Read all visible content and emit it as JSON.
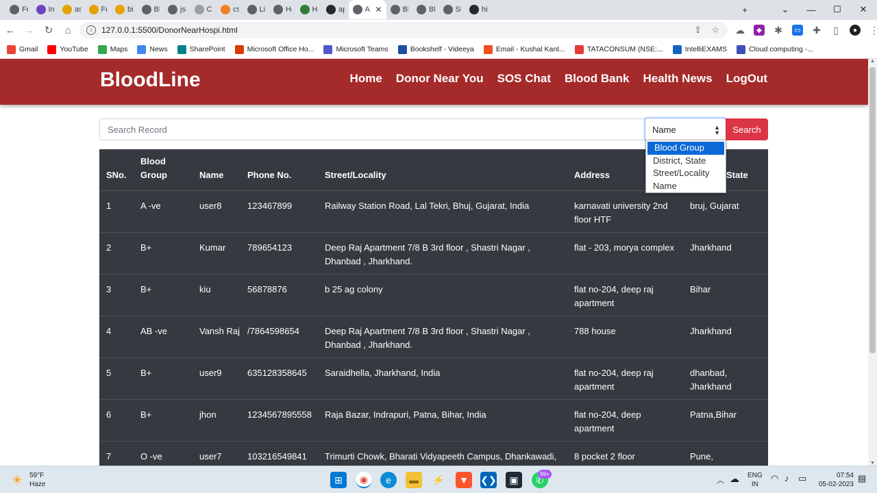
{
  "browser": {
    "tabs": [
      {
        "title": "Frien",
        "icon": "globe-icon",
        "color": "#5f6368"
      },
      {
        "title": "Introc",
        "icon": "bootstrap-icon",
        "color": "#6f42c1"
      },
      {
        "title": "assan",
        "icon": "glitch-icon",
        "color": "#e8a200"
      },
      {
        "title": "Frien",
        "icon": "glitch-icon",
        "color": "#e8a200"
      },
      {
        "title": "bihar",
        "icon": "glitch-icon",
        "color": "#e8a200"
      },
      {
        "title": "Blood",
        "icon": "globe-icon",
        "color": "#5f6368"
      },
      {
        "title": "js-tut",
        "icon": "globe-icon",
        "color": "#5f6368"
      },
      {
        "title": "Creat",
        "icon": "cloud-icon",
        "color": "#9aa0a6"
      },
      {
        "title": "css - ",
        "icon": "stack-icon",
        "color": "#f48024"
      },
      {
        "title": "Live s",
        "icon": "doc-icon",
        "color": "#5f6368"
      },
      {
        "title": "Home",
        "icon": "globe-icon",
        "color": "#5f6368"
      },
      {
        "title": "How t",
        "icon": "code-icon",
        "color": "#2e7d32"
      },
      {
        "title": "apyh",
        "icon": "github-icon",
        "color": "#24292e"
      },
      {
        "title": "A",
        "icon": "globe-icon",
        "color": "#5f6368",
        "active": true
      },
      {
        "title": "Blood",
        "icon": "globe-icon",
        "color": "#5f6368"
      },
      {
        "title": "Blood",
        "icon": "globe-icon",
        "color": "#5f6368"
      },
      {
        "title": "Sign",
        "icon": "globe-icon",
        "color": "#5f6368"
      },
      {
        "title": "hitma",
        "icon": "github-icon",
        "color": "#24292e"
      }
    ],
    "url": "127.0.0.1:5500/DonorNearHospi.html",
    "bookmarks": [
      {
        "label": "Gmail",
        "icon": "gmail-icon",
        "color": "#ea4335"
      },
      {
        "label": "YouTube",
        "icon": "youtube-icon",
        "color": "#ff0000"
      },
      {
        "label": "Maps",
        "icon": "maps-icon",
        "color": "#34a853"
      },
      {
        "label": "News",
        "icon": "news-icon",
        "color": "#4285f4"
      },
      {
        "label": "SharePoint",
        "icon": "sharepoint-icon",
        "color": "#038387"
      },
      {
        "label": "Microsoft Office Ho...",
        "icon": "office-icon",
        "color": "#d83b01"
      },
      {
        "label": "Microsoft Teams",
        "icon": "teams-icon",
        "color": "#5059c9"
      },
      {
        "label": "Bookshelf - Videeya",
        "icon": "bookshelf-icon",
        "color": "#1a4fa0"
      },
      {
        "label": "Email - Kushal Kant...",
        "icon": "windows-icon",
        "color": "#f25022"
      },
      {
        "label": "TATACONSUM (NSE:...",
        "icon": "chart-icon",
        "color": "#e53935"
      },
      {
        "label": "IntelliEXAMS",
        "icon": "x-icon",
        "color": "#1565c0"
      },
      {
        "label": "Cloud computing -...",
        "icon": "s-icon",
        "color": "#3f51b5"
      }
    ]
  },
  "site": {
    "brand": "BloodLine",
    "nav": [
      "Home",
      "Donor Near You",
      "SOS Chat",
      "Blood Bank",
      "Health News",
      "LogOut"
    ]
  },
  "search": {
    "placeholder": "Search Record",
    "selected": "Name",
    "button": "Search",
    "options": [
      "Blood Group",
      "District, State",
      "Street/Locality",
      "Name"
    ],
    "highlighted": "Blood Group"
  },
  "table": {
    "headers": {
      "sno": "SNo.",
      "bg1": "Blood",
      "bg2": "Group",
      "name": "Name",
      "phone": "Phone No.",
      "street": "Street/Locality",
      "address": "Address",
      "state": "State"
    },
    "rows": [
      {
        "sno": "1",
        "bg": "A -ve",
        "name": "user8",
        "phone": "123467899",
        "street": "Railway Station Road, Lal Tekri, Bhuj, Gujarat, India",
        "address": "karnavati university 2nd floor HTF",
        "state": "bruj, Gujarat"
      },
      {
        "sno": "2",
        "bg": "B+",
        "name": "Kumar",
        "phone": "789654123",
        "street": "Deep Raj Apartment 7/8 B 3rd floor , Shastri Nagar , Dhanbad , Jharkhand.",
        "address": "flat - 203, morya complex",
        "state": "Jharkhand"
      },
      {
        "sno": "3",
        "bg": "B+",
        "name": "kiu",
        "phone": "56878876",
        "street": "b 25 ag colony",
        "address": "flat no-204, deep raj apartment",
        "state": "Bihar"
      },
      {
        "sno": "4",
        "bg": "AB -ve",
        "name": "Vansh Raj",
        "phone": "/7864598654",
        "street": "Deep Raj Apartment 7/8 B 3rd floor , Shastri Nagar , Dhanbad , Jharkhand.",
        "address": "788 house",
        "state": "Jharkhand"
      },
      {
        "sno": "5",
        "bg": "B+",
        "name": "user9",
        "phone": "635128358645",
        "street": "Saraidhella, Jharkhand, India",
        "address": "flat no-204, deep raj apartment",
        "state": "dhanbad, Jharkhand"
      },
      {
        "sno": "6",
        "bg": "B+",
        "name": "jhon",
        "phone": "1234567895558",
        "street": "Raja Bazar, Indrapuri, Patna, Bihar, India",
        "address": "flat no-204, deep apartment",
        "state": "Patna,Bihar"
      },
      {
        "sno": "7",
        "bg": "O -ve",
        "name": "user7",
        "phone": "103216549841",
        "street": "Trimurti Chowk, Bharati Vidyapeeth Campus, Dhankawadi,",
        "address": "8 pocket 2 floor",
        "state": "Pune,"
      }
    ]
  },
  "taskbar": {
    "weather_temp": "59°F",
    "weather_desc": "Haze",
    "lang1": "ENG",
    "lang2": "IN",
    "time": "07:54",
    "date": "05-02-2023",
    "badge": "99+"
  }
}
